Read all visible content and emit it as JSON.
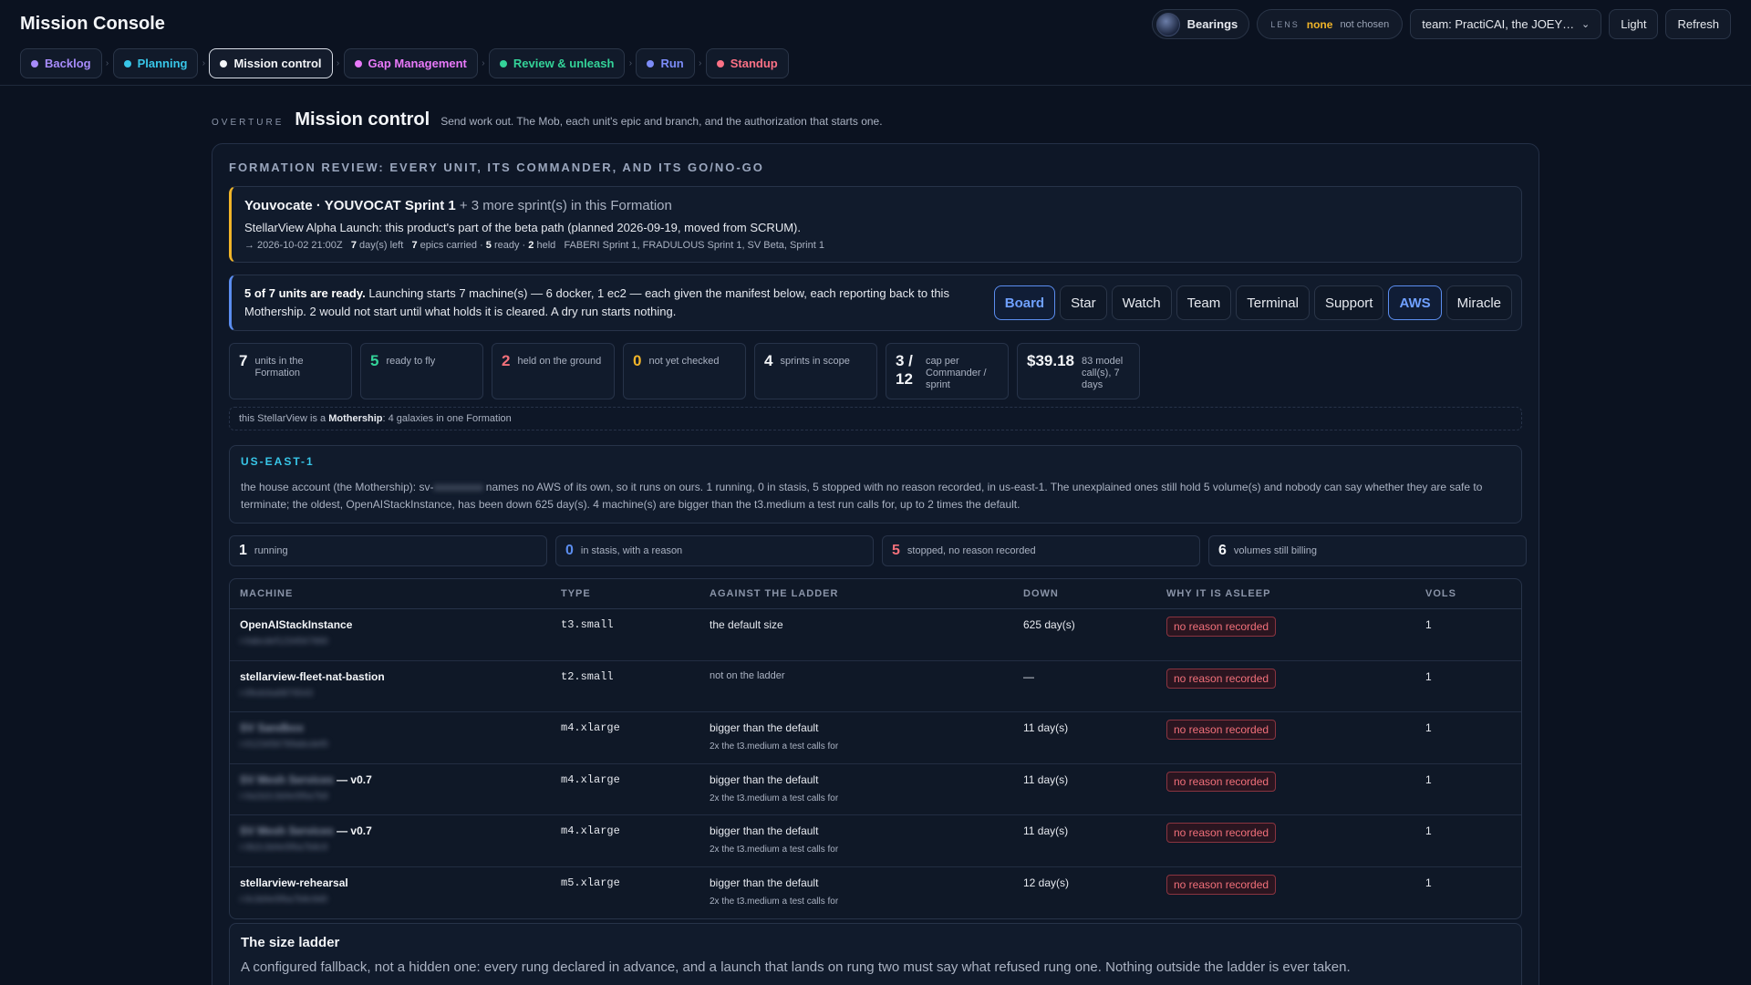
{
  "app": {
    "title": "Mission Console"
  },
  "top": {
    "bearings": "Bearings",
    "lens_key": "LENS",
    "lens_value": "none",
    "lens_sub": "not chosen",
    "team": "team: PractiCAI, the JOEY…",
    "light": "Light",
    "refresh": "Refresh"
  },
  "tabs": [
    {
      "label": "Backlog",
      "color": "#a78bfa"
    },
    {
      "label": "Planning",
      "color": "#38c6e8"
    },
    {
      "label": "Mission control",
      "color": "#f3f5f8"
    },
    {
      "label": "Gap Management",
      "color": "#e879f9"
    },
    {
      "label": "Review & unleash",
      "color": "#34d399"
    },
    {
      "label": "Run",
      "color": "#7c8cf8"
    },
    {
      "label": "Standup",
      "color": "#fb7185"
    }
  ],
  "heading": {
    "overture": "OVERTURE",
    "title": "Mission control",
    "subtitle": "Send work out. The Mob, each unit's epic and branch, and the authorization that starts one."
  },
  "formation": {
    "title": "FORMATION REVIEW: EVERY UNIT, ITS COMMANDER, AND ITS GO/NO-GO",
    "sprint_name": "Youvocate · YOUVOCAT Sprint 1",
    "sprint_more": " + 3 more sprint(s) in this Formation",
    "sprint_desc": "StellarView Alpha Launch: this product's part of the beta path (planned 2026-09-19, moved from SCRUM).",
    "deadline": "→ 2026-10-02 21:00Z",
    "days_left_n": "7",
    "days_left": " day(s) left",
    "epics_n": "7",
    "epics": " epics carried · ",
    "ready_n": "5",
    "ready": " ready · ",
    "held_n": "2",
    "held": " held",
    "others": "FABERI Sprint 1, FRADULOUS Sprint 1, SV Beta, Sprint 1"
  },
  "ready": {
    "bold": "5 of 7 units are ready.",
    "text": " Launching starts 7 machine(s) — 6 docker, 1 ec2 — each given the manifest below, each reporting back to this Mothership. 2 would not start until what holds it is cleared. A dry run starts nothing.",
    "chips": [
      {
        "label": "Board",
        "on": true
      },
      {
        "label": "Star",
        "on": false
      },
      {
        "label": "Watch",
        "on": false
      },
      {
        "label": "Team",
        "on": false
      },
      {
        "label": "Terminal",
        "on": false
      },
      {
        "label": "Support",
        "on": false
      },
      {
        "label": "AWS",
        "on": true
      },
      {
        "label": "Miracle",
        "on": false
      }
    ]
  },
  "stats": [
    {
      "num": "7",
      "label": "units in the Formation",
      "color": "#f3f5f8"
    },
    {
      "num": "5",
      "label": "ready to fly",
      "color": "#34d399"
    },
    {
      "num": "2",
      "label": "held on the ground",
      "color": "#f2707a"
    },
    {
      "num": "0",
      "label": "not yet checked",
      "color": "#f0b429"
    },
    {
      "num": "4",
      "label": "sprints in scope",
      "color": "#f3f5f8"
    },
    {
      "num": "3 / 12",
      "label": "cap per Commander / sprint",
      "color": "#f3f5f8"
    },
    {
      "num": "$39.18",
      "label": "83 model call(s), 7 days",
      "color": "#f3f5f8"
    }
  ],
  "mothership": {
    "pre": "this StellarView is a ",
    "bold": "Mothership",
    "post": ": 4 galaxies in one Formation"
  },
  "region": {
    "name": "US-EAST-1",
    "pre": "the house account (the Mothership): sv-",
    "redacted": "xxxxxxxxx",
    "post": " names no AWS of its own, so it runs on ours. 1 running, 0 in stasis, 5 stopped with no reason recorded, in us-east-1. The unexplained ones still hold 5 volume(s) and nobody can say whether they are safe to terminate; the oldest, OpenAIStackInstance, has been down 625 day(s). 4 machine(s) are bigger than the t3.medium a test run calls for, up to 2 times the default."
  },
  "counts": [
    {
      "num": "1",
      "label": "running",
      "color": "#f3f5f8"
    },
    {
      "num": "0",
      "label": "in stasis, with a reason",
      "color": "#5b8def"
    },
    {
      "num": "5",
      "label": "stopped, no reason recorded",
      "color": "#f2707a"
    },
    {
      "num": "6",
      "label": "volumes still billing",
      "color": "#f3f5f8"
    }
  ],
  "table": {
    "headers": [
      "MACHINE",
      "TYPE",
      "AGAINST THE LADDER",
      "DOWN",
      "WHY IT IS ASLEEP",
      "VOLS"
    ],
    "rows": [
      {
        "name": "OpenAIStackInstance",
        "suffix": "",
        "sub": "i-0abcdef1234567890",
        "type": "t3.small",
        "ladder": "the default size",
        "note": "",
        "dim": false,
        "down": "625 day(s)",
        "why": "no reason recorded",
        "vols": "1"
      },
      {
        "name": "stellarview-fleet-nat-bastion",
        "suffix": "",
        "sub": "i-0fedcba9876543",
        "type": "t2.small",
        "ladder": "not on the ladder",
        "note": "",
        "dim": true,
        "down": "—",
        "why": "no reason recorded",
        "vols": "1"
      },
      {
        "name": "",
        "suffix": "",
        "sub": "i-0123456789abcdef0",
        "type": "m4.xlarge",
        "ladder": "bigger than the default",
        "note": "2x the t3.medium a test calls for",
        "dim": false,
        "down": "11 day(s)",
        "why": "no reason recorded",
        "vols": "1"
      },
      {
        "name": "",
        "suffix": " — v0.7",
        "sub": "i-0a1b2c3d4e5f6a7b8",
        "type": "m4.xlarge",
        "ladder": "bigger than the default",
        "note": "2x the t3.medium a test calls for",
        "dim": false,
        "down": "11 day(s)",
        "why": "no reason recorded",
        "vols": "1"
      },
      {
        "name": "",
        "suffix": " — v0.7",
        "sub": "i-0b2c3d4e5f6a7b8c9",
        "type": "m4.xlarge",
        "ladder": "bigger than the default",
        "note": "2x the t3.medium a test calls for",
        "dim": false,
        "down": "11 day(s)",
        "why": "no reason recorded",
        "vols": "1"
      },
      {
        "name": "stellarview-rehearsal",
        "suffix": "",
        "sub": "i-0c3d4e5f6a7b8c9d0",
        "type": "m5.xlarge",
        "ladder": "bigger than the default",
        "note": "2x the t3.medium a test calls for",
        "dim": false,
        "down": "12 day(s)",
        "why": "no reason recorded",
        "vols": "1"
      }
    ]
  },
  "size_ladder": {
    "title": "The size ladder",
    "text": "A configured fallback, not a hidden one: every rung declared in advance, and a launch that lands on rung two must say what refused rung one. Nothing outside the ladder is ever taken."
  }
}
